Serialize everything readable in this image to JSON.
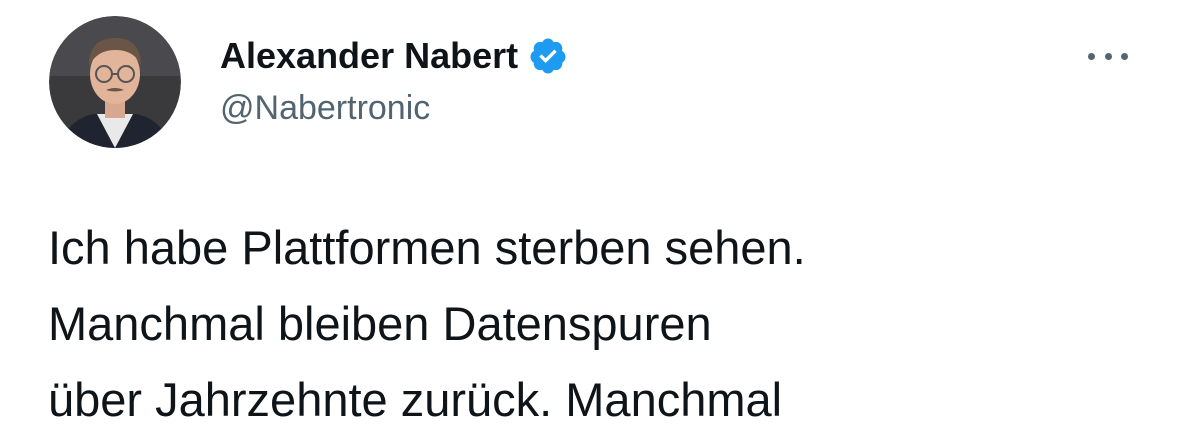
{
  "author": {
    "display_name": "Alexander Nabert",
    "handle": "@Nabertronic",
    "verified": true,
    "verified_icon": "verified-badge-icon",
    "avatar_icon": "profile-photo"
  },
  "menu": {
    "icon": "more-options-icon"
  },
  "tweet": {
    "lines": [
      "Ich habe Plattformen sterben sehen.",
      "Manchmal bleiben Datenspuren",
      "über Jahrzehnte zurück. Manchmal"
    ]
  },
  "colors": {
    "text_primary": "#0f1419",
    "text_secondary": "#536471",
    "verified_blue": "#1d9bf0",
    "background": "#ffffff"
  }
}
